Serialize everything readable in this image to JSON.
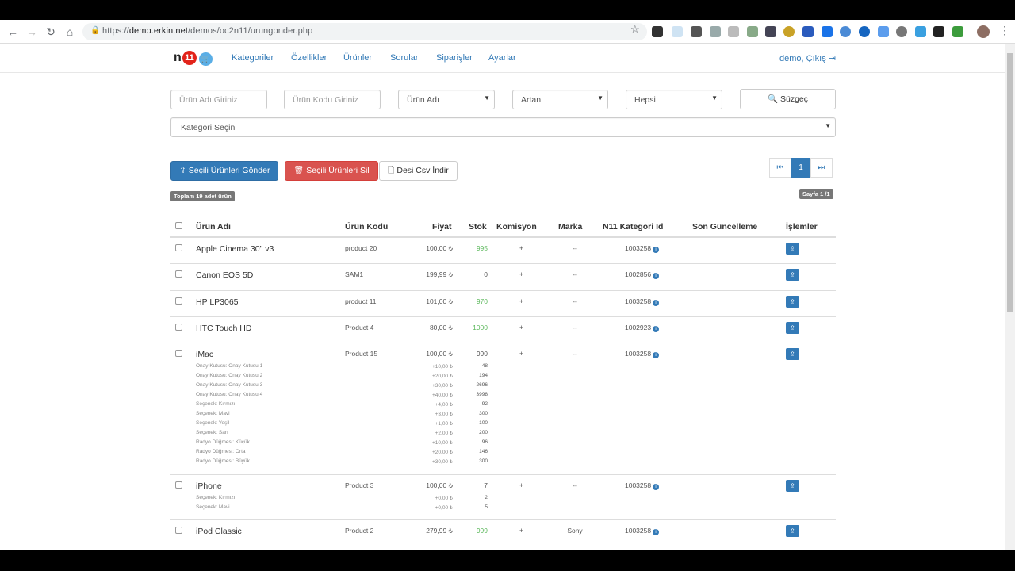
{
  "browser": {
    "url_prefix": "https://",
    "url_host": "demo.erkin.net",
    "url_path": "/demos/oc2n11/urungonder.php"
  },
  "nav": {
    "logo_n": "n",
    "logo_11": "11",
    "links": [
      "Kategoriler",
      "Özellikler",
      "Ürünler",
      "Sorular",
      "Siparişler",
      "Ayarlar"
    ],
    "user": "demo, Çıkış"
  },
  "filters": {
    "product_name_placeholder": "Ürün Adı Giriniz",
    "product_code_placeholder": "Ürün Kodu Giriniz",
    "sort_field": "Ürün Adı",
    "sort_order": "Artan",
    "status": "Hepsi",
    "filter_button": "Süzgeç",
    "category": "Kategori Seçin"
  },
  "actions": {
    "send": "Seçili Ürünleri Gönder",
    "delete": "Seçili Ürünleri Sil",
    "csv": "Desi Csv İndir"
  },
  "pagination": {
    "current": "1",
    "page_label": "Sayfa 1 /1"
  },
  "total_label": "Toplam 19 adet ürün",
  "table": {
    "headers": [
      "Ürün Adı",
      "Ürün Kodu",
      "Fiyat",
      "Stok",
      "Komisyon",
      "Marka",
      "N11 Kategori Id",
      "Son Güncelleme",
      "İşlemler"
    ],
    "rows": [
      {
        "name": "Apple Cinema 30\" v3",
        "code": "product 20",
        "price": "100,00 ₺",
        "stock": "995",
        "commission": "+",
        "brand": "--",
        "category": "1003258"
      },
      {
        "name": "Canon EOS 5D",
        "code": "SAM1",
        "price": "199,99 ₺",
        "stock": "0",
        "commission": "+",
        "brand": "--",
        "category": "1002856"
      },
      {
        "name": "HP LP3065",
        "code": "product 11",
        "price": "101,00 ₺",
        "stock": "970",
        "commission": "+",
        "brand": "--",
        "category": "1003258"
      },
      {
        "name": "HTC Touch HD",
        "code": "Product 4",
        "price": "80,00 ₺",
        "stock": "1000",
        "commission": "+",
        "brand": "--",
        "category": "1002923"
      },
      {
        "name": "iMac",
        "code": "Product 15",
        "price": "100,00 ₺",
        "stock": "990",
        "commission": "+",
        "brand": "--",
        "category": "1003258",
        "options": [
          {
            "label": "Onay Kutusu: Onay Kutusu 1",
            "price": "+10,00 ₺",
            "stock": "48"
          },
          {
            "label": "Onay Kutusu: Onay Kutusu 2",
            "price": "+20,00 ₺",
            "stock": "194"
          },
          {
            "label": "Onay Kutusu: Onay Kutusu 3",
            "price": "+30,00 ₺",
            "stock": "2696"
          },
          {
            "label": "Onay Kutusu: Onay Kutusu 4",
            "price": "+40,00 ₺",
            "stock": "3998"
          },
          {
            "label": "Seçenek: Kırmızı",
            "price": "+4,00 ₺",
            "stock": "92"
          },
          {
            "label": "Seçenek: Mavi",
            "price": "+3,00 ₺",
            "stock": "300"
          },
          {
            "label": "Seçenek: Yeşil",
            "price": "+1,00 ₺",
            "stock": "100"
          },
          {
            "label": "Seçenek: Sarı",
            "price": "+2,00 ₺",
            "stock": "200"
          },
          {
            "label": "Radyo Düğmesi: Küçük",
            "price": "+10,00 ₺",
            "stock": "96"
          },
          {
            "label": "Radyo Düğmesi: Orta",
            "price": "+20,00 ₺",
            "stock": "146"
          },
          {
            "label": "Radyo Düğmesi: Büyük",
            "price": "+30,00 ₺",
            "stock": "300"
          }
        ]
      },
      {
        "name": "iPhone",
        "code": "Product 3",
        "price": "100,00 ₺",
        "stock": "7",
        "commission": "+",
        "brand": "--",
        "category": "1003258",
        "options": [
          {
            "label": "Seçenek: Kırmızı",
            "price": "+0,00 ₺",
            "stock": "2"
          },
          {
            "label": "Seçenek: Mavi",
            "price": "+0,00 ₺",
            "stock": "5"
          }
        ]
      },
      {
        "name": "iPod Classic",
        "code": "Product 2",
        "price": "279,99 ₺",
        "stock": "999",
        "commission": "+",
        "brand": "Sony",
        "category": "1003258"
      }
    ]
  },
  "colors": {
    "primary": "#337ab7",
    "danger": "#d9534f",
    "success": "#5cb85c"
  }
}
